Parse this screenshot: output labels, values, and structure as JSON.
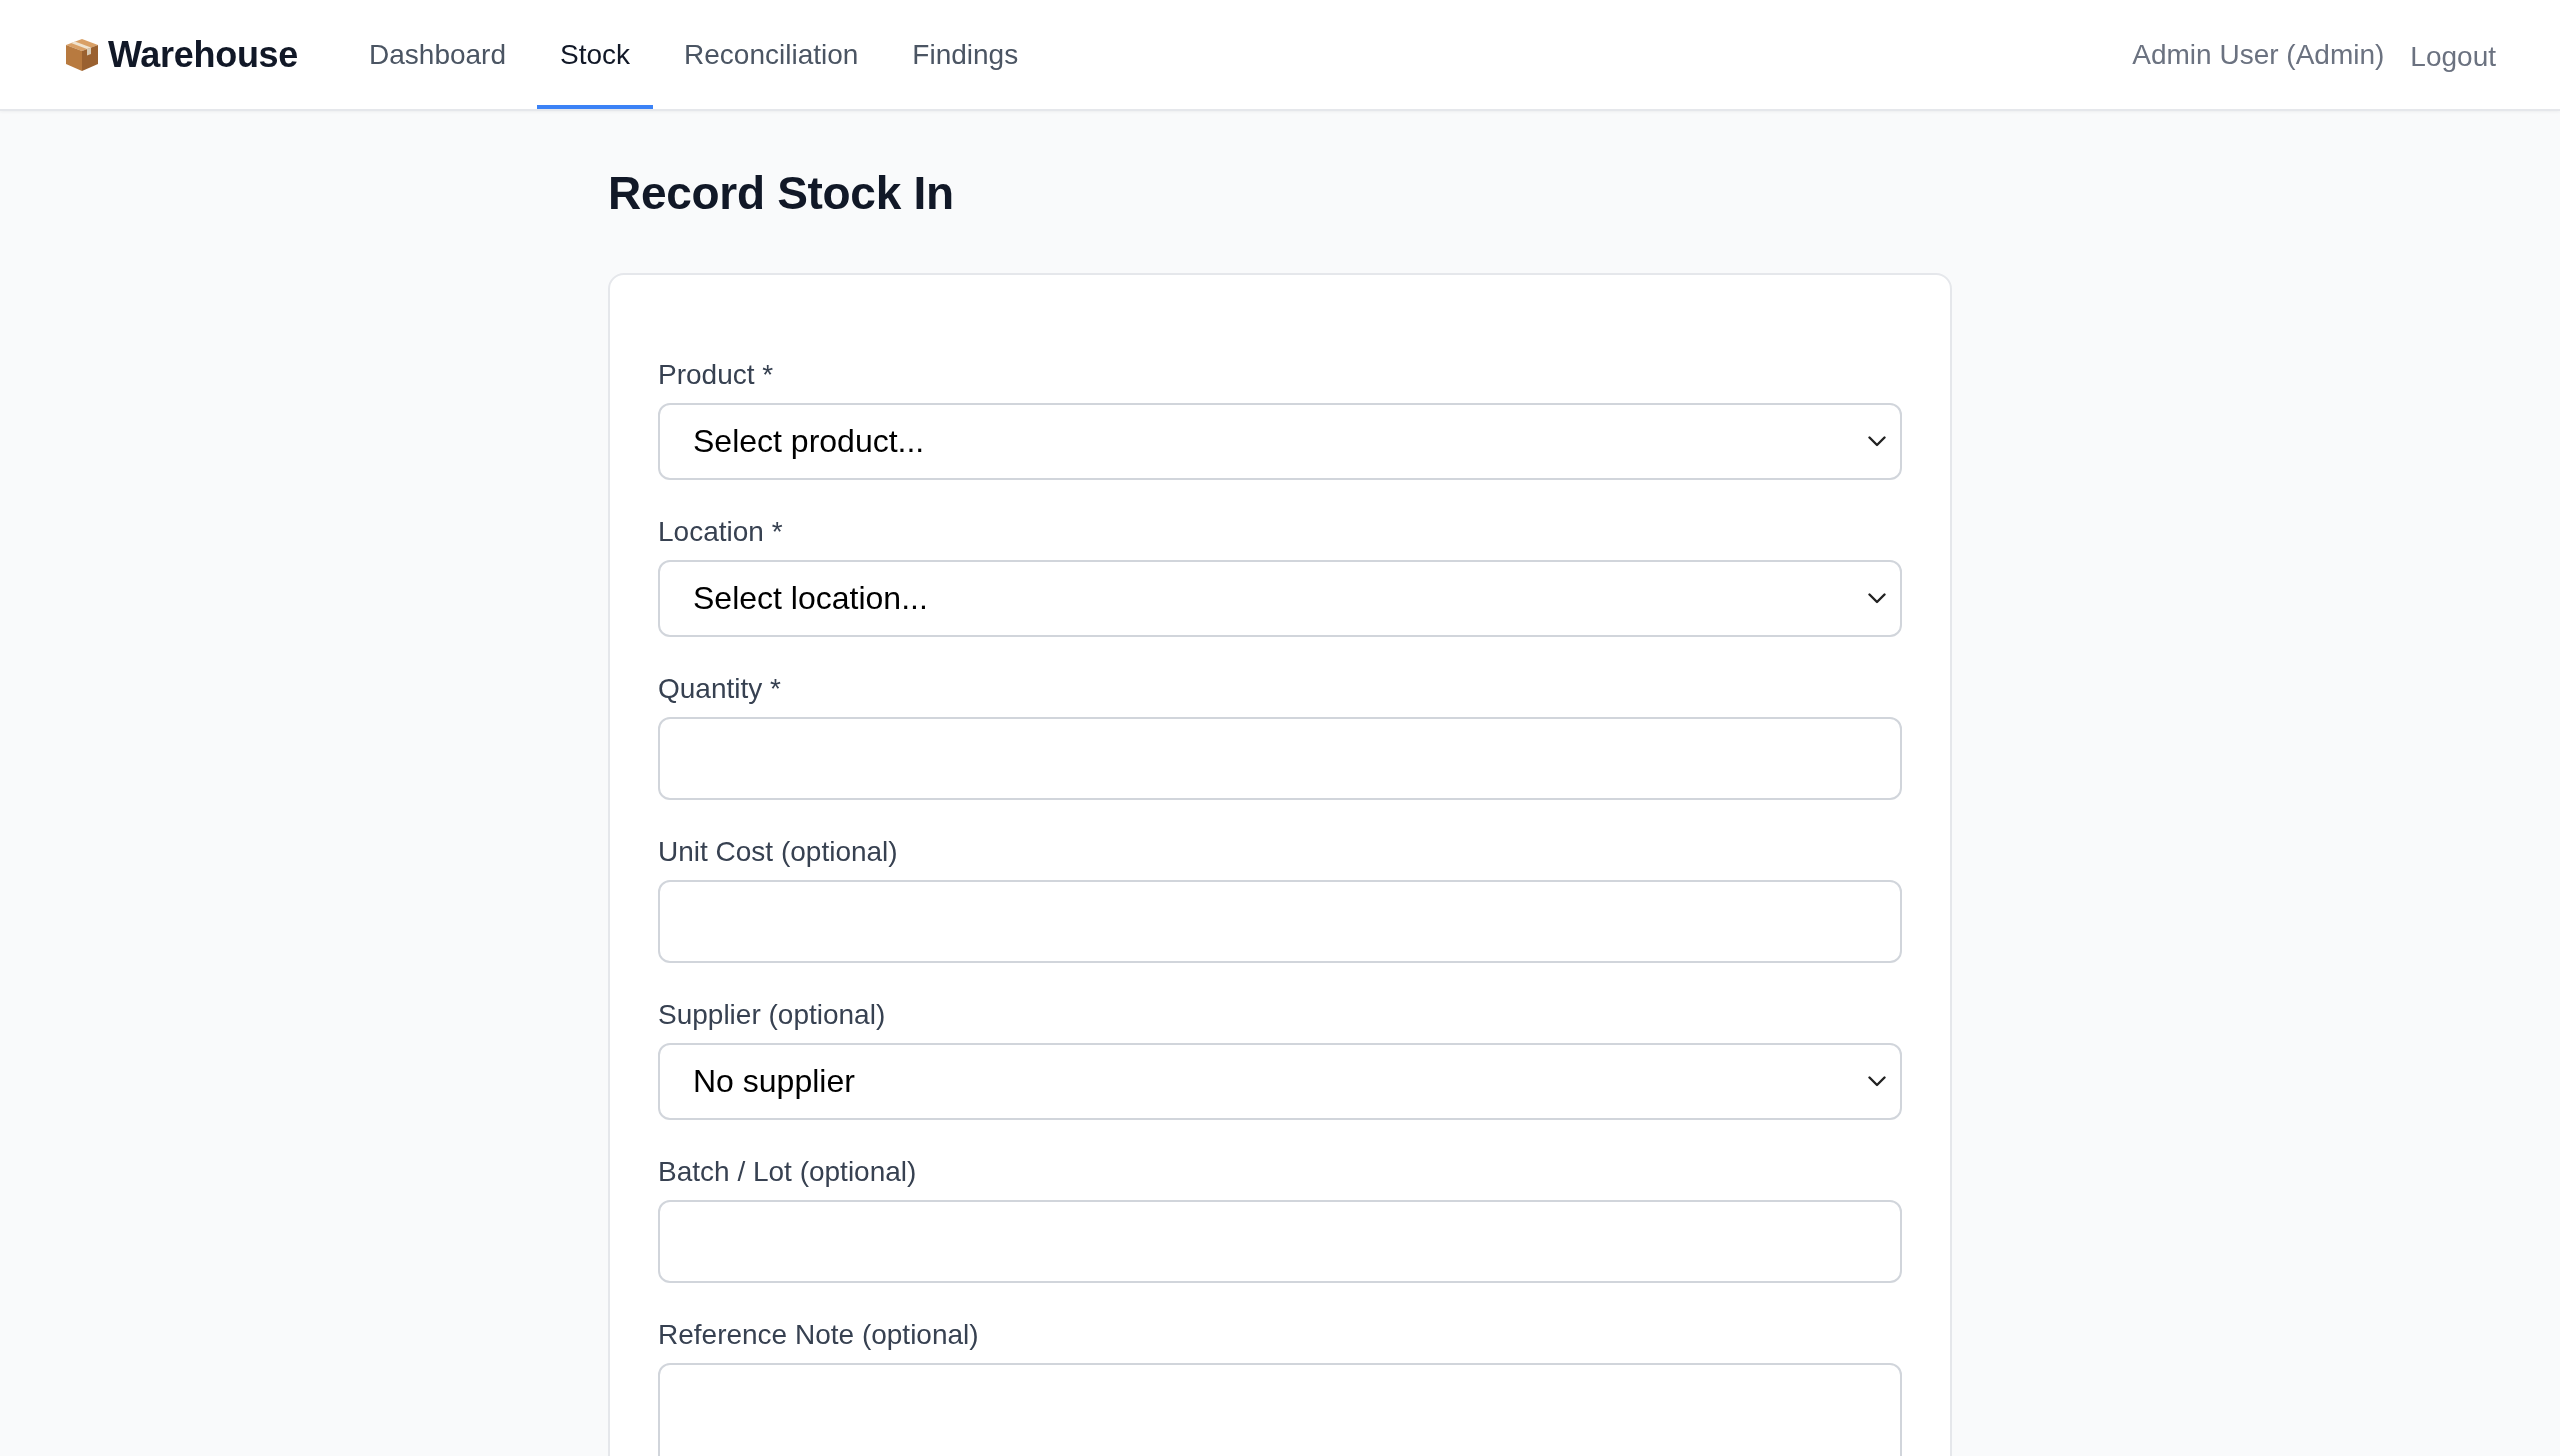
{
  "header": {
    "brand": "Warehouse",
    "nav": [
      {
        "label": "Dashboard",
        "selected": false
      },
      {
        "label": "Stock",
        "selected": true
      },
      {
        "label": "Reconciliation",
        "selected": false
      },
      {
        "label": "Findings",
        "selected": false
      }
    ],
    "user": "Admin User (Admin)",
    "logout": "Logout"
  },
  "title": "Record Stock In",
  "form": {
    "fields": [
      {
        "kind": "select",
        "label": "Product *",
        "value": "Select product..."
      },
      {
        "kind": "select",
        "label": "Location *",
        "value": "Select location..."
      },
      {
        "kind": "input",
        "label": "Quantity *"
      },
      {
        "kind": "input",
        "label": "Unit Cost (optional)"
      },
      {
        "kind": "select",
        "label": "Supplier (optional)",
        "value": "No supplier"
      },
      {
        "kind": "input",
        "label": "Batch / Lot (optional)"
      },
      {
        "kind": "textarea",
        "label": "Reference Note (optional)"
      }
    ]
  }
}
